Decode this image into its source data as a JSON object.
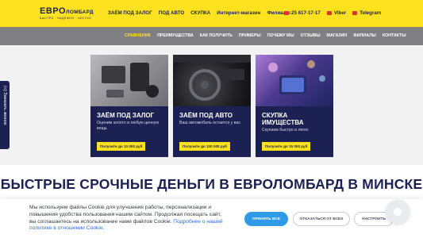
{
  "header": {
    "logo": {
      "evro": "ЕВРО",
      "lombard": "ЛОМБАРД",
      "tagline": "БЫСТРО · НАДЁЖНО · ЧЕСТНО"
    },
    "nav": [
      "ЗАЁМ ПОД ЗАЛОГ",
      "ПОД АВТО",
      "СКУПКА",
      "Интернет-магазин",
      "Филиалы"
    ],
    "contacts": [
      {
        "label": "25 617-17-17",
        "icon": "phone-icon"
      },
      {
        "label": "Viber",
        "icon": "viber-icon"
      },
      {
        "label": "Telegram",
        "icon": "telegram-icon"
      }
    ]
  },
  "subnav": {
    "items": [
      "СРАВНЕНИЕ",
      "ПРЕИМУЩЕСТВА",
      "КАК ПОЛУЧИТЬ",
      "ПРИМЕРЫ",
      "ПОЧЕМУ МЫ",
      "ОТЗЫВЫ",
      "МАГАЗИН",
      "ФИЛИАЛЫ",
      "КОНТАКТЫ"
    ],
    "active": 0
  },
  "side_tab": {
    "label": "(«) Заказать звонок"
  },
  "cards": [
    {
      "title": "ЗАЁМ ПОД ЗАЛОГ",
      "desc": "Оценим золото и любую ценную вещь",
      "button": "Получите до 10 000 руб"
    },
    {
      "title": "ЗАЁМ ПОД АВТО",
      "desc": "Ваш автомобиль остается у вас",
      "button": "Получите до 100 000 руб"
    },
    {
      "title": "СКУПКА ИМУЩЕСТВА",
      "desc": "Скупаем быстро и легко",
      "button": "Получите до 15 000 руб"
    }
  ],
  "section": {
    "heading": "БЫСТРЫЕ СРОЧНЫЕ ДЕНЬГИ В ЕВРОЛОМБАРД В МИНСКЕ"
  },
  "cookie": {
    "text": "Мы используем файлы Cookie для улучшения работы, персонализации и повышения удобства пользования нашим сайтом. Продолжая посещать сайт, вы соглашаетесь на использование нами файлов Cookie.",
    "link": "Подробнее о нашей политике в отношении Cookie.",
    "accept": "ПРИНЯТЬ ВСЕ",
    "reject": "ОТКАЗАТЬСЯ ОТ ВСЕХ",
    "settings": "НАСТРОИТЬ"
  },
  "colors": {
    "brand_yellow": "#ffe21f",
    "brand_navy": "#1b2152",
    "nav_gray": "#808083",
    "accept_blue": "#2e9be8"
  }
}
